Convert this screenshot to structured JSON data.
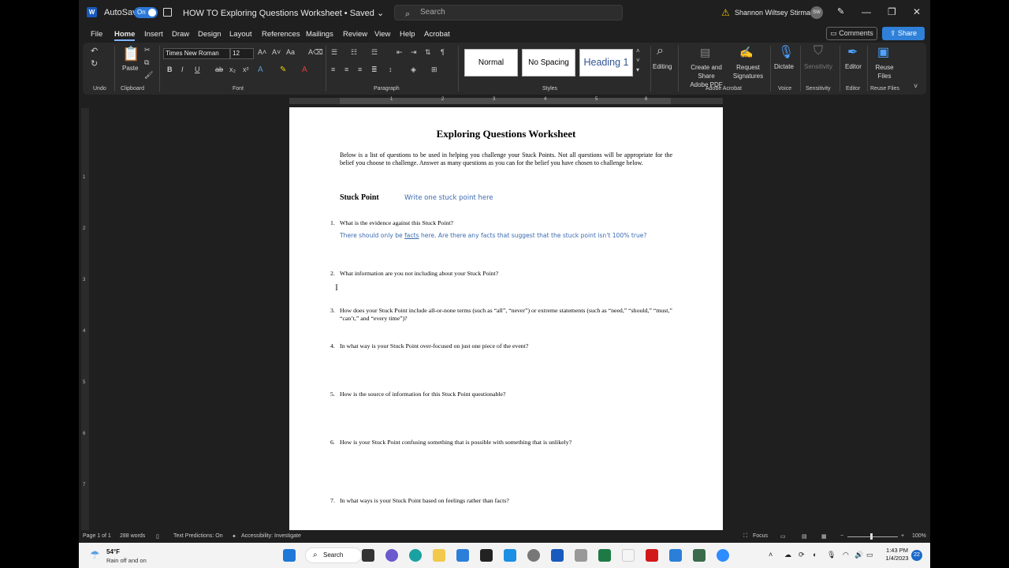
{
  "titlebar": {
    "autosave_label": "AutoSave",
    "autosave_state": "On",
    "document_title": "HOW TO Exploring Questions Worksheet • Saved ⌄",
    "search_placeholder": "Search",
    "user_name": "Shannon Wiltsey Stirman",
    "user_initials": "SW"
  },
  "menu": {
    "tabs": [
      "File",
      "Home",
      "Insert",
      "Draw",
      "Design",
      "Layout",
      "References",
      "Mailings",
      "Review",
      "View",
      "Help",
      "Acrobat"
    ],
    "active_tab": "Home",
    "comments_label": "Comments",
    "share_label": "Share"
  },
  "ribbon": {
    "groups": {
      "undo": "Undo",
      "clipboard": "Clipboard",
      "font": "Font",
      "paragraph": "Paragraph",
      "styles": "Styles",
      "adobe": "Adobe Acrobat",
      "voice": "Voice",
      "sensitivity": "Sensitivity",
      "editor": "Editor",
      "reuse": "Reuse Files"
    },
    "paste_label": "Paste",
    "font_name": "Times New Roman",
    "font_size": "12",
    "styles": [
      "Normal",
      "No Spacing",
      "Heading 1"
    ],
    "editing_label": "Editing",
    "create_share_pdf": [
      "Create and Share",
      "Adobe PDF"
    ],
    "request_signatures": [
      "Request",
      "Signatures"
    ],
    "dictate_label": "Dictate",
    "sensitivity_label": "Sensitivity",
    "editor_label": "Editor",
    "reuse_files": [
      "Reuse",
      "Files"
    ]
  },
  "ruler": {
    "numbers": [
      "1",
      "2",
      "3",
      "4",
      "5",
      "6"
    ],
    "vertical_numbers": [
      "1",
      "2",
      "3",
      "4",
      "5",
      "6",
      "7"
    ]
  },
  "document": {
    "title": "Exploring Questions Worksheet",
    "intro": "Below is a list of questions to be used in helping you challenge your Stuck Points. Not all questions will be appropriate for the belief you choose to challenge. Answer as many questions as you can for the belief you have chosen to challenge below.",
    "stuck_point_label": "Stuck Point",
    "stuck_point_placeholder": "Write one stuck point here",
    "answer_1_part1": "There should only be ",
    "answer_1_underlined": "facts",
    "answer_1_part2": " here. Are there any facts that suggest that the stuck point isn't 100% true?",
    "questions": [
      {
        "num": "1.",
        "text": "What is the evidence against this Stuck Point?"
      },
      {
        "num": "2.",
        "text": "What information are you not including about your Stuck Point?"
      },
      {
        "num": "3.",
        "text": "How does your Stuck Point include all-or-none terms (such as “all”, “never”) or extreme statements (such as “need,” “should,” “must,” “can’t,” and “every time”)?"
      },
      {
        "num": "4.",
        "text": "In what way is your Stuck Point over-focused on just one piece of the event?"
      },
      {
        "num": "5.",
        "text": "How is the source of information for this Stuck Point questionable?"
      },
      {
        "num": "6.",
        "text": "How is your Stuck Point confusing something that is possible with something that is unlikely?"
      },
      {
        "num": "7.",
        "text": "In what ways is your Stuck Point based on feelings rather than facts?"
      }
    ]
  },
  "statusbar": {
    "page": "Page 1 of 1",
    "words": "288 words",
    "text_predictions": "Text Predictions: On",
    "accessibility": "Accessibility: Investigate",
    "focus": "Focus",
    "zoom": "100%"
  },
  "taskbar": {
    "weather_temp": "54°F",
    "weather_desc": "Rain off and on",
    "search_label": "Search",
    "time": "1:43 PM",
    "date": "1/4/2023",
    "notifications": "22"
  },
  "colors": {
    "accent": "#2f80d8",
    "handwriting_blue": "#3b6bb0",
    "heading_blue": "#2f5496"
  }
}
